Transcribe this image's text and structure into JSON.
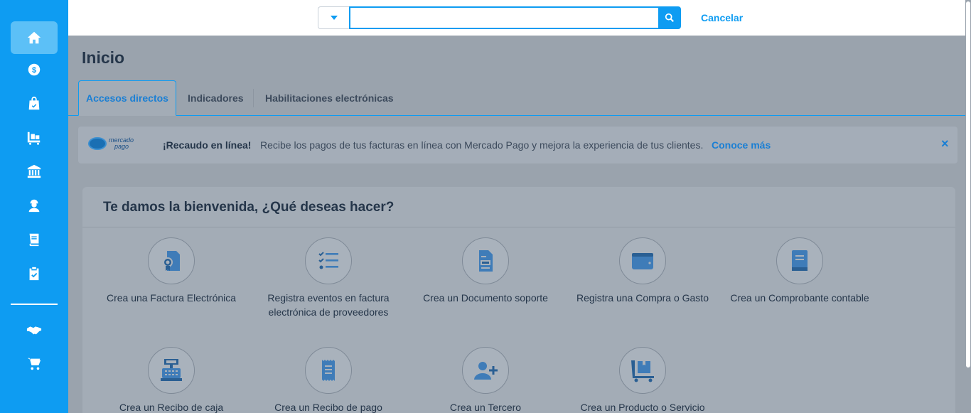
{
  "sidebar": {
    "items": [
      {
        "icon": "home-icon",
        "active": true
      },
      {
        "icon": "dollar-coin-icon"
      },
      {
        "icon": "shopping-bag-icon"
      },
      {
        "icon": "pallet-cart-icon"
      },
      {
        "icon": "bank-icon"
      },
      {
        "icon": "user-worker-icon"
      },
      {
        "icon": "book-icon"
      },
      {
        "icon": "clipboard-check-icon"
      },
      {
        "icon": "handshake-icon"
      },
      {
        "icon": "cart-icon"
      }
    ]
  },
  "search": {
    "value": "",
    "placeholder": "",
    "cancel_label": "Cancelar"
  },
  "page": {
    "title": "Inicio"
  },
  "tabs": [
    {
      "label": "Accesos directos",
      "active": true
    },
    {
      "label": "Indicadores"
    },
    {
      "label": "Habilitaciones electrónicas"
    }
  ],
  "banner": {
    "logo_text_line1": "mercado",
    "logo_text_line2": "pago",
    "bold": "¡Recaudo en línea!",
    "text": "Recibe los pagos de tus facturas en línea con Mercado Pago y mejora la experiencia de tus clientes.",
    "link": "Conoce más",
    "close": "×"
  },
  "welcome": {
    "title": "Te damos la bienvenida, ¿Qué deseas hacer?",
    "actions": [
      {
        "label": "Crea una Factura Electrónica",
        "icon": "invoice-certificate-icon"
      },
      {
        "label": "Registra eventos en factura electrónica de proveedores",
        "icon": "checklist-icon"
      },
      {
        "label": "Crea un Documento soporte",
        "icon": "document-icon"
      },
      {
        "label": "Registra una Compra o Gasto",
        "icon": "wallet-icon"
      },
      {
        "label": "Crea un Comprobante contable",
        "icon": "ledger-book-icon"
      },
      {
        "label": "Crea un Recibo de caja",
        "icon": "cash-register-icon"
      },
      {
        "label": "Crea un Recibo de pago",
        "icon": "receipt-icon"
      },
      {
        "label": "Crea un Tercero",
        "icon": "add-user-icon"
      },
      {
        "label": "Crea un Producto o Servicio",
        "icon": "product-cart-icon"
      }
    ]
  },
  "colors": {
    "brand": "#0e9cf2",
    "overlay": "#9aa3ad",
    "text_dark": "#25364a",
    "link": "#1a7fd4"
  }
}
